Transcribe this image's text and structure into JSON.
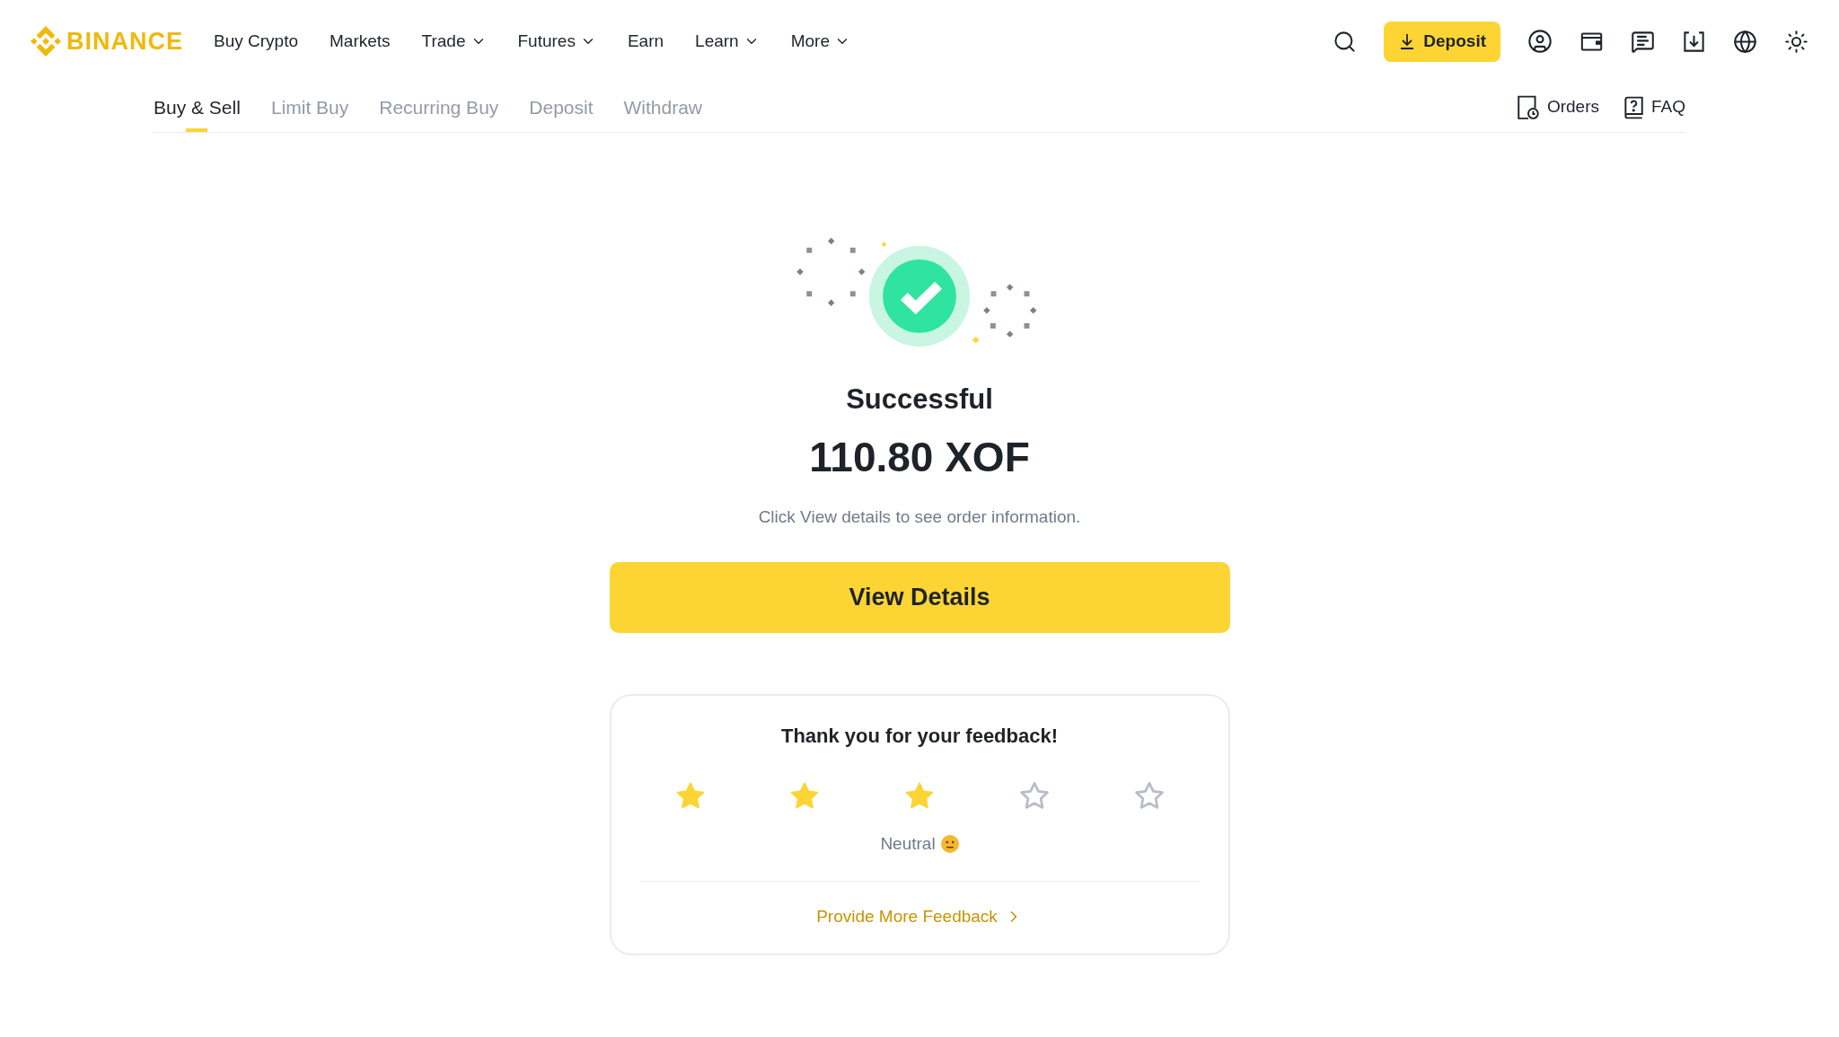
{
  "header": {
    "logo": "BINANCE",
    "nav": [
      {
        "label": "Buy Crypto",
        "kind": "link"
      },
      {
        "label": "Markets",
        "kind": "link"
      },
      {
        "label": "Trade",
        "kind": "menu"
      },
      {
        "label": "Futures",
        "kind": "menu"
      },
      {
        "label": "Earn",
        "kind": "link"
      },
      {
        "label": "Learn",
        "kind": "menu"
      },
      {
        "label": "More",
        "kind": "menu"
      }
    ],
    "deposit_button": "Deposit"
  },
  "tabs": [
    {
      "label": "Buy & Sell",
      "selected": true
    },
    {
      "label": "Limit Buy",
      "selected": false
    },
    {
      "label": "Recurring Buy",
      "selected": false
    },
    {
      "label": "Deposit",
      "selected": false
    },
    {
      "label": "Withdraw",
      "selected": false
    }
  ],
  "tab_links": [
    {
      "label": "Orders",
      "kind": "orders"
    },
    {
      "label": "FAQ",
      "kind": "faq"
    }
  ],
  "result": {
    "status": "Successful",
    "amount": "110.80 XOF",
    "hint": "Click View details to see order information.",
    "button": "View Details"
  },
  "feedback": {
    "title": "Thank you for your feedback!",
    "stars": 3,
    "rating_label": "Neutral",
    "link": "Provide More Feedback"
  }
}
